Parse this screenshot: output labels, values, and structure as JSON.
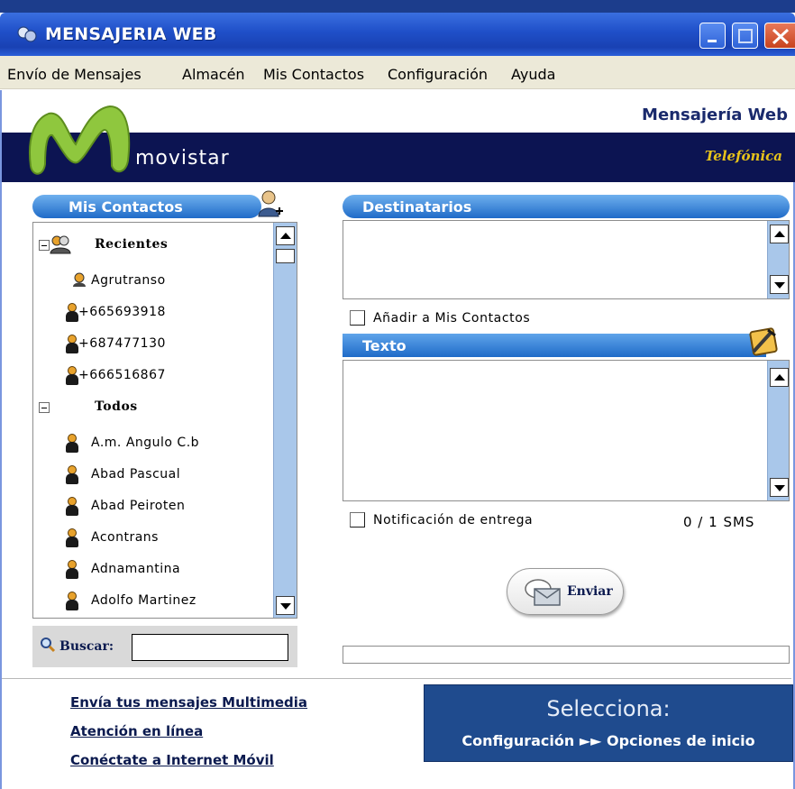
{
  "window": {
    "title": "MENSAJERIA WEB"
  },
  "menu": {
    "items": [
      "Envío de Mensajes",
      "Almacén",
      "Mis Contactos",
      "Configuración",
      "Ayuda"
    ]
  },
  "header": {
    "title": "Mensajería Web",
    "brand": "movistar",
    "company": "Telefónica"
  },
  "contacts": {
    "title": "Mis Contactos",
    "groups": [
      {
        "label": "Recientes",
        "items": [
          "Agrutranso",
          "+665693918",
          "+687477130",
          "+666516867"
        ]
      },
      {
        "label": "Todos",
        "items": [
          "A.m. Angulo C.b",
          "Abad Pascual",
          "Abad Peiroten",
          "Acontrans",
          "Adnamantina",
          "Adolfo Martinez"
        ]
      }
    ],
    "search_label": "Buscar:",
    "search_value": ""
  },
  "compose": {
    "recipients_title": "Destinatarios",
    "recipients_value": "",
    "add_contacts_label": "Añadir a Mis Contactos",
    "text_title": "Texto",
    "text_value": "",
    "delivery_label": "Notificación de entrega",
    "counter": "0 / 1 SMS",
    "send_label": "Enviar"
  },
  "footer": {
    "links": [
      "Envía tus mensajes Multimedia",
      "Atención en línea",
      "Conéctate a Internet Móvil"
    ],
    "promo_line1": "Selecciona:",
    "promo_line2": "Configuración ►► Opciones de inicio"
  },
  "colors": {
    "titlebar": "#1f4fc8",
    "banner_dark": "#0c1452",
    "pill_blue": "#1f6bc8",
    "scroll_track": "#a9c7ea",
    "promo_bg": "#1f4b8e",
    "telefonica_gold": "#e7c31b"
  }
}
